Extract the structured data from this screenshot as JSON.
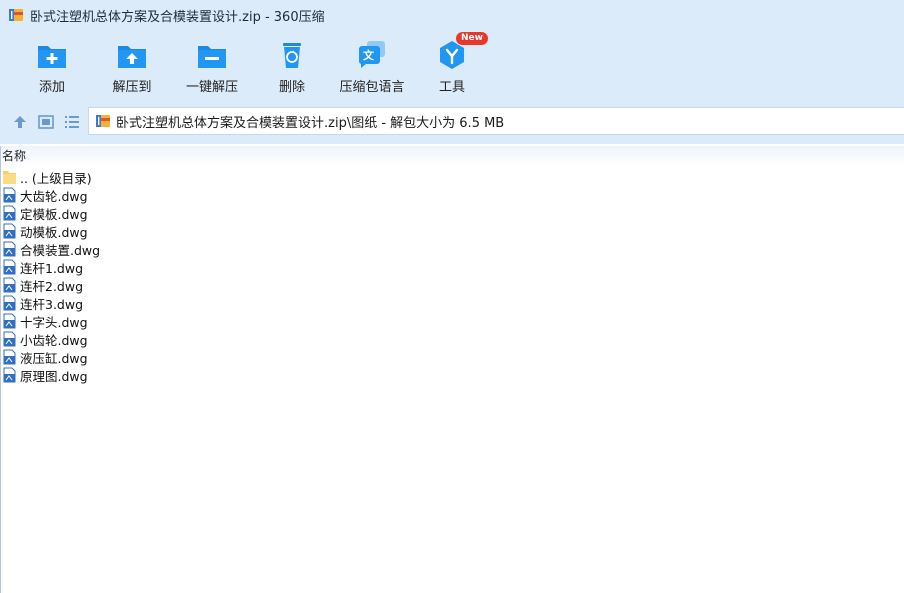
{
  "window": {
    "title": "卧式注塑机总体方案及合模装置设计.zip - 360压缩",
    "app_icon": "archive-icon"
  },
  "toolbar": {
    "add_label": "添加",
    "extract_to_label": "解压到",
    "one_click_extract_label": "一键解压",
    "delete_label": "删除",
    "language_label": "压缩包语言",
    "tools_label": "工具",
    "tools_badge": "New"
  },
  "navbar": {
    "path_text": "卧式注塑机总体方案及合模装置设计.zip\\图纸 - 解包大小为 6.5 MB"
  },
  "list": {
    "column_name_label": "名称",
    "parent_label": ".. (上级目录)",
    "files": [
      "大齿轮.dwg",
      "定模板.dwg",
      "动模板.dwg",
      "合模装置.dwg",
      "连杆1.dwg",
      "连杆2.dwg",
      "连杆3.dwg",
      "十字头.dwg",
      "小齿轮.dwg",
      "液压缸.dwg",
      "原理图.dwg"
    ]
  },
  "colors": {
    "chrome_bg": "#dcebfa",
    "icon_blue": "#1e88e5",
    "badge_red": "#e8362c"
  }
}
